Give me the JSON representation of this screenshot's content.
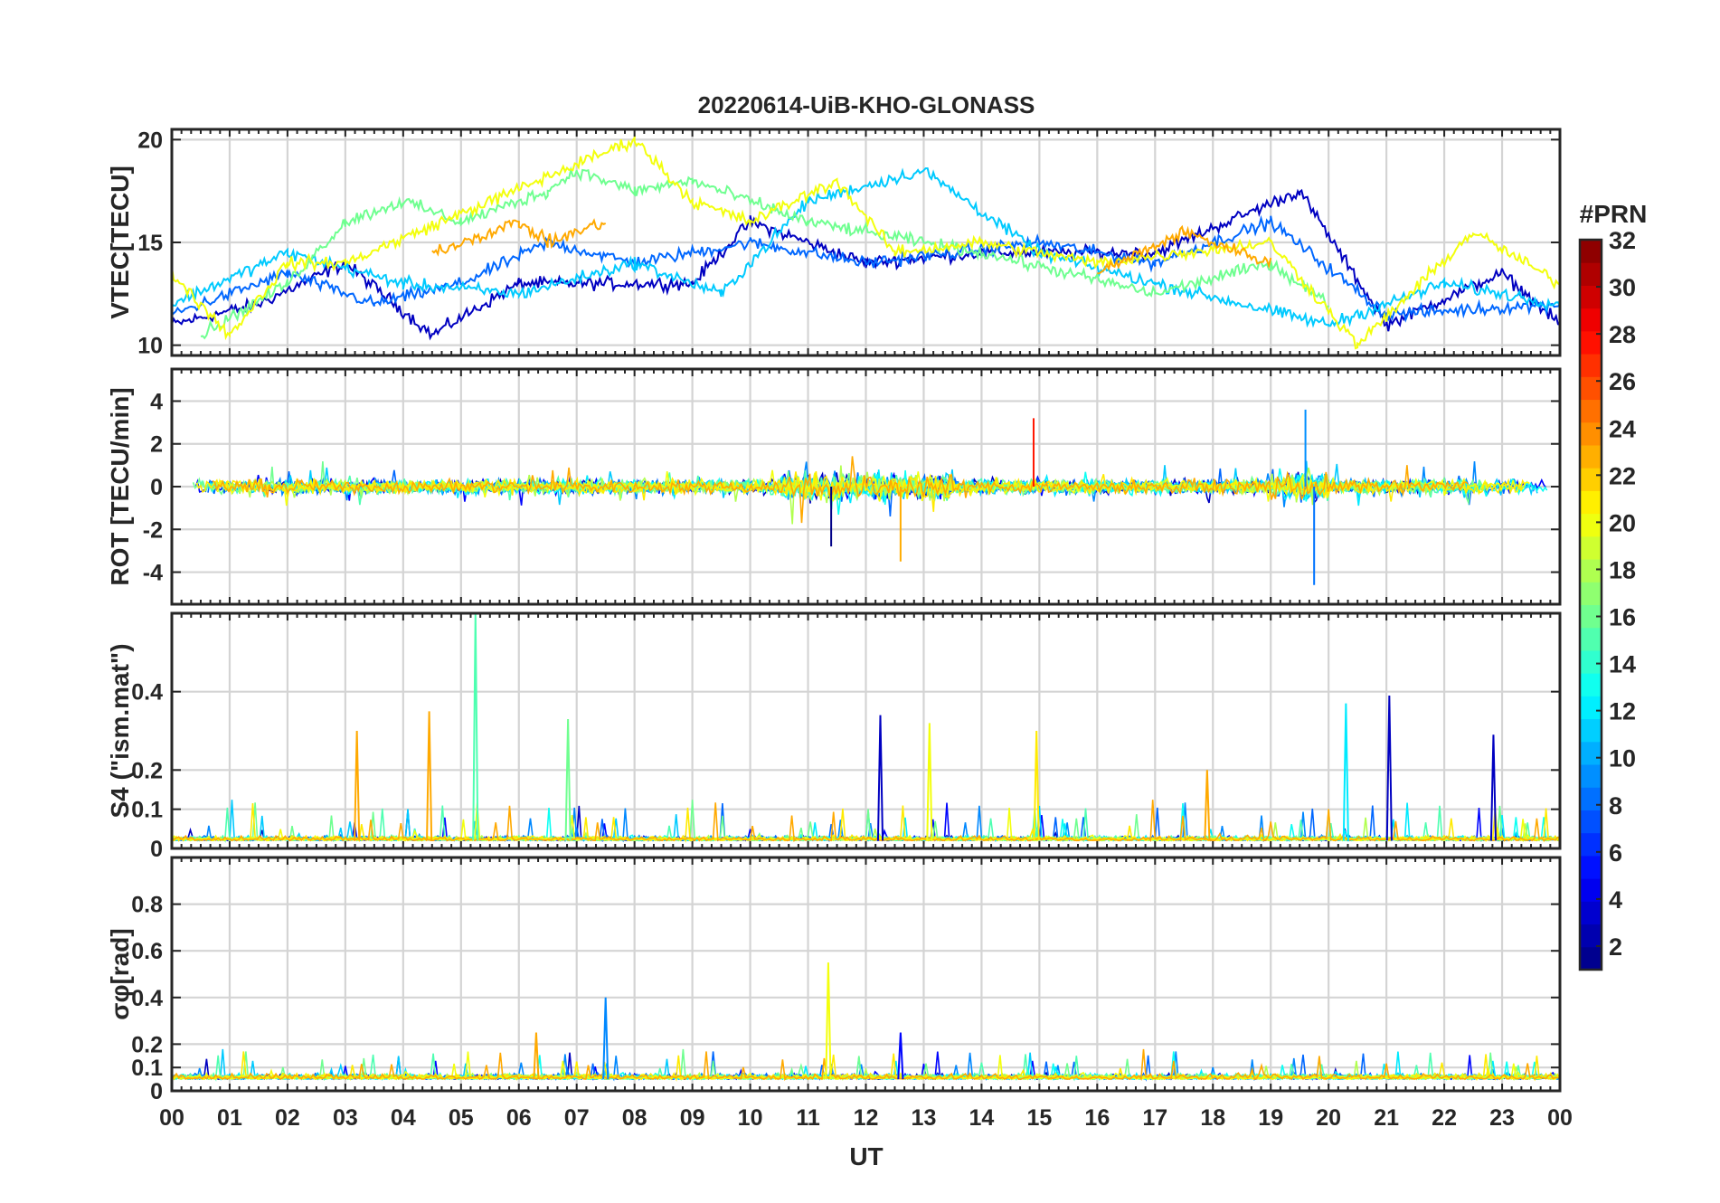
{
  "figure": {
    "title": "20220614-UiB-KHO-GLONASS",
    "xlabel": "UT",
    "x_ticks": [
      "00",
      "01",
      "02",
      "03",
      "04",
      "05",
      "06",
      "07",
      "08",
      "09",
      "10",
      "11",
      "12",
      "13",
      "14",
      "15",
      "16",
      "17",
      "18",
      "19",
      "20",
      "21",
      "22",
      "23",
      "00"
    ],
    "xlim": [
      0,
      24
    ]
  },
  "colorbar": {
    "label": "#PRN",
    "range": [
      1,
      32
    ],
    "ticks": [
      2,
      4,
      6,
      8,
      10,
      12,
      14,
      16,
      18,
      20,
      22,
      24,
      26,
      28,
      30,
      32
    ],
    "colormap": "jet",
    "levels": 32
  },
  "chart_data": [
    {
      "type": "line",
      "panel": "vtec",
      "ylabel": "VTEC[TECU]",
      "ylim": [
        9.5,
        20.5
      ],
      "yticks": [
        10,
        15,
        20
      ],
      "grid": true,
      "series_note_prn": [
        3,
        5,
        8,
        11,
        13,
        16,
        18,
        20,
        23
      ],
      "series": [
        {
          "prn": 3,
          "x": [
            0,
            1.5,
            3,
            4.5,
            6,
            9,
            10,
            12,
            14,
            17,
            19.5,
            21,
            23,
            24
          ],
          "y": [
            11,
            12,
            14,
            10.5,
            13,
            13,
            16,
            14,
            14.5,
            14.5,
            17.5,
            11,
            13.5,
            11
          ]
        },
        {
          "prn": 8,
          "x": [
            0,
            2,
            3.5,
            5,
            6.5,
            8,
            10,
            12,
            15,
            17,
            19,
            21,
            24
          ],
          "y": [
            11.5,
            13.5,
            12,
            13,
            15,
            14,
            15,
            14,
            15,
            14,
            16,
            11.5,
            12
          ]
        },
        {
          "prn": 11,
          "x": [
            0,
            2,
            4,
            6,
            8,
            9.5,
            11,
            13,
            15,
            17,
            20,
            22,
            24
          ],
          "y": [
            12,
            14.5,
            13,
            12.5,
            14,
            12.5,
            17,
            18.5,
            14.5,
            13,
            11,
            13,
            12
          ]
        },
        {
          "prn": 16,
          "x": [
            0.5,
            2,
            3,
            4,
            5,
            6.5,
            7,
            8,
            9,
            11,
            14,
            17,
            19,
            20
          ],
          "y": [
            10.5,
            13,
            16,
            17,
            16,
            17.5,
            18.5,
            17.5,
            18,
            16,
            14.5,
            12.5,
            14,
            12
          ]
        },
        {
          "prn": 20,
          "x": [
            0,
            1,
            2,
            3,
            8,
            9,
            10,
            11.5,
            12.5,
            14,
            16,
            19,
            20.5,
            22.5,
            24
          ],
          "y": [
            13.5,
            10.5,
            14,
            14,
            20,
            17,
            16,
            18,
            14.5,
            15,
            14,
            15,
            10,
            15.5,
            13
          ]
        },
        {
          "prn": 23,
          "x": [
            4.5,
            6,
            6.5,
            7.5
          ],
          "y": [
            14.5,
            16,
            15,
            16
          ]
        },
        {
          "prn": 23,
          "x": [
            16,
            17.5,
            19
          ],
          "y": [
            13.5,
            15.5,
            14
          ]
        }
      ]
    },
    {
      "type": "line",
      "panel": "rot",
      "ylabel": "ROT [TECU/min]",
      "ylim": [
        -5.5,
        5.5
      ],
      "yticks": [
        -4,
        -2,
        0,
        2,
        4
      ],
      "grid": true,
      "notes_peaks": [
        {
          "x": 19.75,
          "y": -4.6
        },
        {
          "x": 19.6,
          "y": 3.6
        },
        {
          "x": 12.6,
          "y": -3.5
        },
        {
          "x": 11.4,
          "y": -2.8
        },
        {
          "x": 14.9,
          "y": 3.2
        }
      ]
    },
    {
      "type": "line",
      "panel": "s4",
      "ylabel": "S4 (\"ism.mat\")",
      "ylim": [
        0,
        0.6
      ],
      "yticks": [
        0,
        0.1,
        0.2,
        0.4
      ],
      "grid": true,
      "peaks": [
        {
          "x": 5.25,
          "y": 0.6,
          "prn": 15
        },
        {
          "x": 4.45,
          "y": 0.35,
          "prn": 23
        },
        {
          "x": 3.2,
          "y": 0.3,
          "prn": 23
        },
        {
          "x": 6.85,
          "y": 0.33,
          "prn": 16
        },
        {
          "x": 12.25,
          "y": 0.34,
          "prn": 3
        },
        {
          "x": 13.1,
          "y": 0.32,
          "prn": 20
        },
        {
          "x": 14.95,
          "y": 0.3,
          "prn": 21
        },
        {
          "x": 20.3,
          "y": 0.37,
          "prn": 12
        },
        {
          "x": 21.05,
          "y": 0.39,
          "prn": 3
        },
        {
          "x": 22.85,
          "y": 0.29,
          "prn": 3
        },
        {
          "x": 17.9,
          "y": 0.2,
          "prn": 23
        }
      ]
    },
    {
      "type": "line",
      "panel": "sigma_phi",
      "ylabel": "σφ[rad]",
      "ylim": [
        0,
        1
      ],
      "yticks": [
        0,
        0.1,
        0.2,
        0.4,
        0.6,
        0.8
      ],
      "grid": true,
      "peaks": [
        {
          "x": 11.35,
          "y": 0.55,
          "prn": 20
        },
        {
          "x": 7.5,
          "y": 0.4,
          "prn": 9
        },
        {
          "x": 6.3,
          "y": 0.25,
          "prn": 23
        },
        {
          "x": 12.6,
          "y": 0.25,
          "prn": 5
        }
      ]
    }
  ]
}
